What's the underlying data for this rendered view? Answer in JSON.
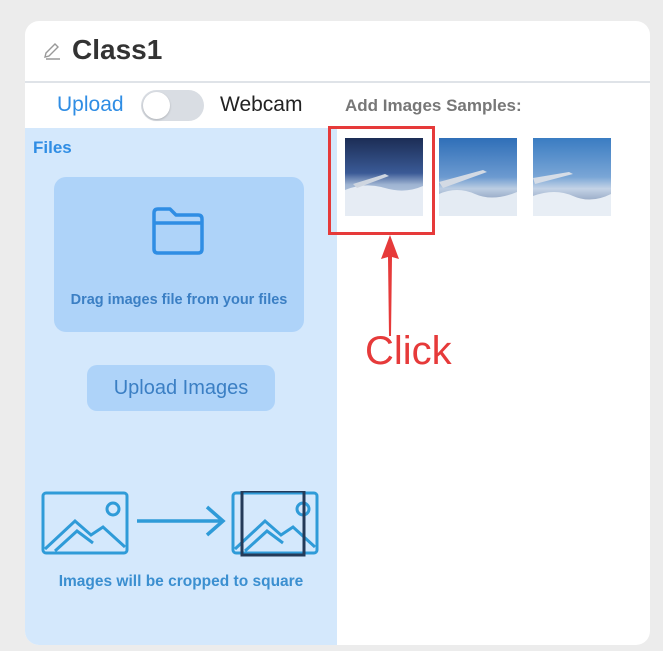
{
  "header": {
    "title": "Class1",
    "icon": "pencil-icon"
  },
  "tabs": {
    "upload_label": "Upload",
    "webcam_label": "Webcam",
    "toggle_on": false
  },
  "samples": {
    "label": "Add Images Samples:",
    "images": [
      {
        "name": "sample-image-1",
        "selected": true
      },
      {
        "name": "sample-image-2",
        "selected": false
      },
      {
        "name": "sample-image-3",
        "selected": false
      }
    ]
  },
  "upload_panel": {
    "files_label": "Files",
    "dropzone_text": "Drag images file from your files",
    "upload_button": "Upload Images",
    "crop_note": "Images will be cropped to square"
  },
  "annotation": {
    "text": "Click",
    "color": "#e63a3a"
  },
  "colors": {
    "accent": "#2f8de4",
    "panel": "#d4e8fc",
    "dropzone": "#aed3f9"
  }
}
